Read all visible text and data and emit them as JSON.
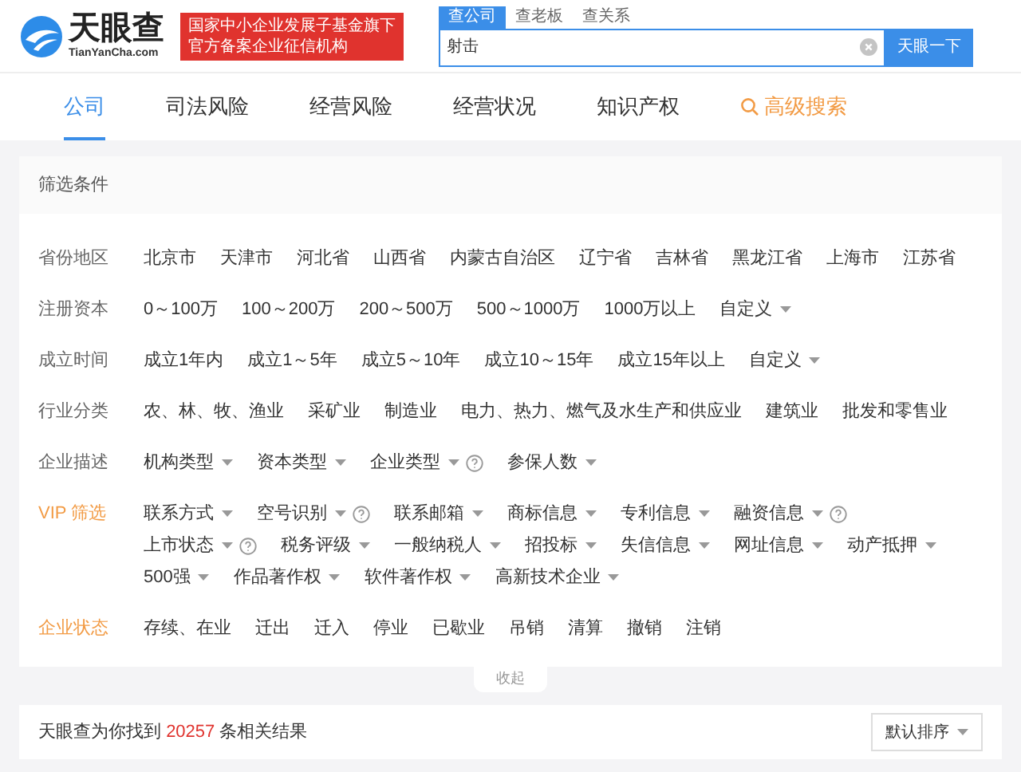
{
  "logo": {
    "name": "天眼查",
    "domain": "TianYanCha.com"
  },
  "badge": {
    "lines": [
      "国家中小企业发展子基金旗下",
      "官方备案企业征信机构"
    ]
  },
  "search": {
    "tabs": [
      {
        "label": "查公司",
        "selected": true
      },
      {
        "label": "查老板",
        "selected": false
      },
      {
        "label": "查关系",
        "selected": false
      }
    ],
    "value": "射击",
    "button": "天眼一下"
  },
  "nav": [
    {
      "label": "公司",
      "selected": true,
      "kind": "tab"
    },
    {
      "label": "司法风险",
      "selected": false,
      "kind": "tab"
    },
    {
      "label": "经营风险",
      "selected": false,
      "kind": "tab"
    },
    {
      "label": "经营状况",
      "selected": false,
      "kind": "tab"
    },
    {
      "label": "知识产权",
      "selected": false,
      "kind": "tab"
    },
    {
      "label": "高级搜索",
      "selected": false,
      "kind": "advanced"
    }
  ],
  "filter": {
    "title": "筛选条件",
    "rows": [
      {
        "label": "省份地区",
        "highlight": false,
        "options": [
          {
            "label": "北京市"
          },
          {
            "label": "天津市"
          },
          {
            "label": "河北省"
          },
          {
            "label": "山西省"
          },
          {
            "label": "内蒙古自治区"
          },
          {
            "label": "辽宁省"
          },
          {
            "label": "吉林省"
          },
          {
            "label": "黑龙江省"
          },
          {
            "label": "上海市"
          },
          {
            "label": "江苏省"
          }
        ]
      },
      {
        "label": "注册资本",
        "highlight": false,
        "options": [
          {
            "label": "0～100万"
          },
          {
            "label": "100～200万"
          },
          {
            "label": "200～500万"
          },
          {
            "label": "500～1000万"
          },
          {
            "label": "1000万以上"
          },
          {
            "label": "自定义",
            "dropdown": true
          }
        ]
      },
      {
        "label": "成立时间",
        "highlight": false,
        "options": [
          {
            "label": "成立1年内"
          },
          {
            "label": "成立1～5年"
          },
          {
            "label": "成立5～10年"
          },
          {
            "label": "成立10～15年"
          },
          {
            "label": "成立15年以上"
          },
          {
            "label": "自定义",
            "dropdown": true
          }
        ]
      },
      {
        "label": "行业分类",
        "highlight": false,
        "options": [
          {
            "label": "农、林、牧、渔业"
          },
          {
            "label": "采矿业"
          },
          {
            "label": "制造业"
          },
          {
            "label": "电力、热力、燃气及水生产和供应业"
          },
          {
            "label": "建筑业"
          },
          {
            "label": "批发和零售业"
          }
        ]
      },
      {
        "label": "企业描述",
        "highlight": false,
        "options": [
          {
            "label": "机构类型",
            "dropdown": true
          },
          {
            "label": "资本类型",
            "dropdown": true
          },
          {
            "label": "企业类型",
            "dropdown": true,
            "help": true
          },
          {
            "label": "参保人数",
            "dropdown": true
          }
        ]
      },
      {
        "label": "VIP 筛选",
        "highlight": true,
        "options": [
          {
            "label": "联系方式",
            "dropdown": true
          },
          {
            "label": "空号识别",
            "dropdown": true,
            "help": true
          },
          {
            "label": "联系邮箱",
            "dropdown": true
          },
          {
            "label": "商标信息",
            "dropdown": true
          },
          {
            "label": "专利信息",
            "dropdown": true
          },
          {
            "label": "融资信息",
            "dropdown": true,
            "help": true
          },
          {
            "label": "上市状态",
            "dropdown": true,
            "help": true
          },
          {
            "label": "税务评级",
            "dropdown": true
          },
          {
            "label": "一般纳税人",
            "dropdown": true
          },
          {
            "label": "招投标",
            "dropdown": true
          },
          {
            "label": "失信信息",
            "dropdown": true
          },
          {
            "label": "网址信息",
            "dropdown": true
          },
          {
            "label": "动产抵押",
            "dropdown": true
          },
          {
            "label": "500强",
            "dropdown": true
          },
          {
            "label": "作品著作权",
            "dropdown": true
          },
          {
            "label": "软件著作权",
            "dropdown": true
          },
          {
            "label": "高新技术企业",
            "dropdown": true
          }
        ]
      },
      {
        "label": "企业状态",
        "highlight": true,
        "options": [
          {
            "label": "存续、在业"
          },
          {
            "label": "迁出"
          },
          {
            "label": "迁入"
          },
          {
            "label": "停业"
          },
          {
            "label": "已歇业"
          },
          {
            "label": "吊销"
          },
          {
            "label": "清算"
          },
          {
            "label": "撤销"
          },
          {
            "label": "注销"
          }
        ]
      }
    ],
    "collapse": "收起"
  },
  "results": {
    "before": "天眼查为你找到",
    "count": "20257",
    "after": "条相关结果",
    "sort": "默认排序"
  }
}
